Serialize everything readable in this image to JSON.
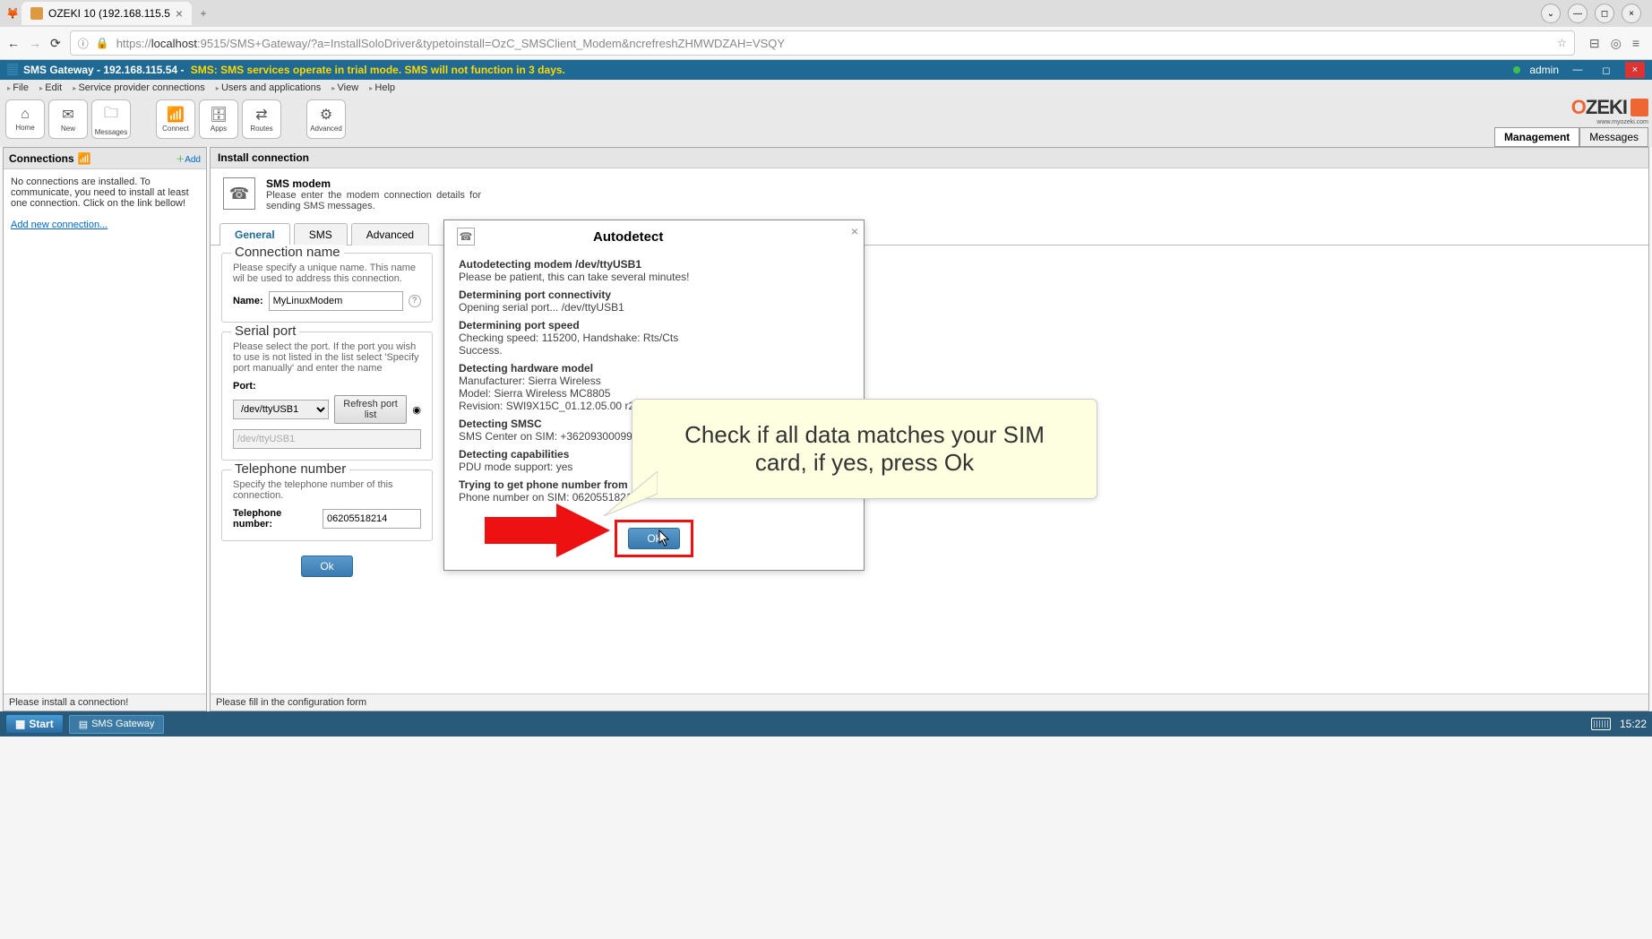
{
  "browser": {
    "tab_title": "OZEKI 10 (192.168.115.5",
    "url_display_prefix": "https://",
    "url_display_host": "localhost",
    "url_display_path": ":9515/SMS+Gateway/?a=InstallSoloDriver&typetoinstall=OzC_SMSClient_Modem&ncrefreshZHMWDZAH=VSQY"
  },
  "app_header": {
    "title": "SMS Gateway - 192.168.115.54 - ",
    "warning": "SMS: SMS services operate in trial mode. SMS will not function in 3 days.",
    "user": "admin"
  },
  "menus": [
    "File",
    "Edit",
    "Service provider connections",
    "Users and applications",
    "View",
    "Help"
  ],
  "toolbar": [
    {
      "icon": "⌂",
      "label": "Home"
    },
    {
      "icon": "✉",
      "label": "New"
    },
    {
      "icon": "🗀",
      "label": "Messages"
    },
    {
      "icon": "📶",
      "label": "Connect"
    },
    {
      "icon": "🗄",
      "label": "Apps"
    },
    {
      "icon": "⇄",
      "label": "Routes"
    },
    {
      "icon": "⚙",
      "label": "Advanced"
    }
  ],
  "brand": {
    "name1": "O",
    "name2": "ZEKI",
    "sub": "www.myozeki.com",
    "tabs": [
      "Management",
      "Messages"
    ]
  },
  "left_pane": {
    "title": "Connections",
    "add": "Add",
    "body": "No connections are installed. To communicate, you need to install at least one connection. Click on the link bellow!",
    "link": "Add new connection...",
    "status": "Please install a connection!"
  },
  "right_pane": {
    "title": "Install connection",
    "intro_title": "SMS modem",
    "intro_text": "Please enter the modem connection details for sending SMS messages.",
    "tabs": [
      "General",
      "SMS",
      "Advanced"
    ],
    "fs_conn": {
      "legend": "Connection name",
      "desc": "Please specify a unique name. This name wil be used to address this connection.",
      "name_label": "Name:",
      "name_value": "MyLinuxModem"
    },
    "fs_serial": {
      "legend": "Serial port",
      "desc": "Please select the port. If the port you wish to use is not listed in the list select 'Specify port manually' and enter the name",
      "port_label": "Port:",
      "port_value": "/dev/ttyUSB1",
      "refresh": "Refresh port list",
      "manual": "/dev/ttyUSB1"
    },
    "fs_tel": {
      "legend": "Telephone number",
      "desc": "Specify the telephone number of this connection.",
      "tel_label": "Telephone number:",
      "tel_value": "06205518214"
    },
    "ok": "Ok",
    "status": "Please fill in the configuration form"
  },
  "modal": {
    "title": "Autodetect",
    "h1": "Autodetecting modem /dev/ttyUSB1",
    "p1": "Please be patient, this can take several minutes!",
    "h2": "Determining port connectivity",
    "p2": "Opening serial port... /dev/ttyUSB1",
    "h3": "Determining port speed",
    "p3a": "Checking speed: 115200, Handshake: Rts/Cts",
    "p3b": "Success.",
    "h4": "Detecting hardware model",
    "p4a": "Manufacturer: Sierra Wireless",
    "p4b": "Model: Sierra Wireless MC8805",
    "p4c": "Revision: SWI9X15C_01.12.05.00 r205",
    "h5": "Detecting SMSC",
    "p5": "SMS Center on SIM: +36209300099",
    "h6": "Detecting capabilities",
    "p6": "PDU mode support: yes",
    "h7": "Trying to get phone number from",
    "p7": "Phone number on SIM: 06205518214",
    "ok": "Ok"
  },
  "callout": "Check if all data matches your SIM card, if yes, press Ok",
  "taskbar": {
    "start": "Start",
    "task": "SMS Gateway",
    "time": "15:22"
  }
}
